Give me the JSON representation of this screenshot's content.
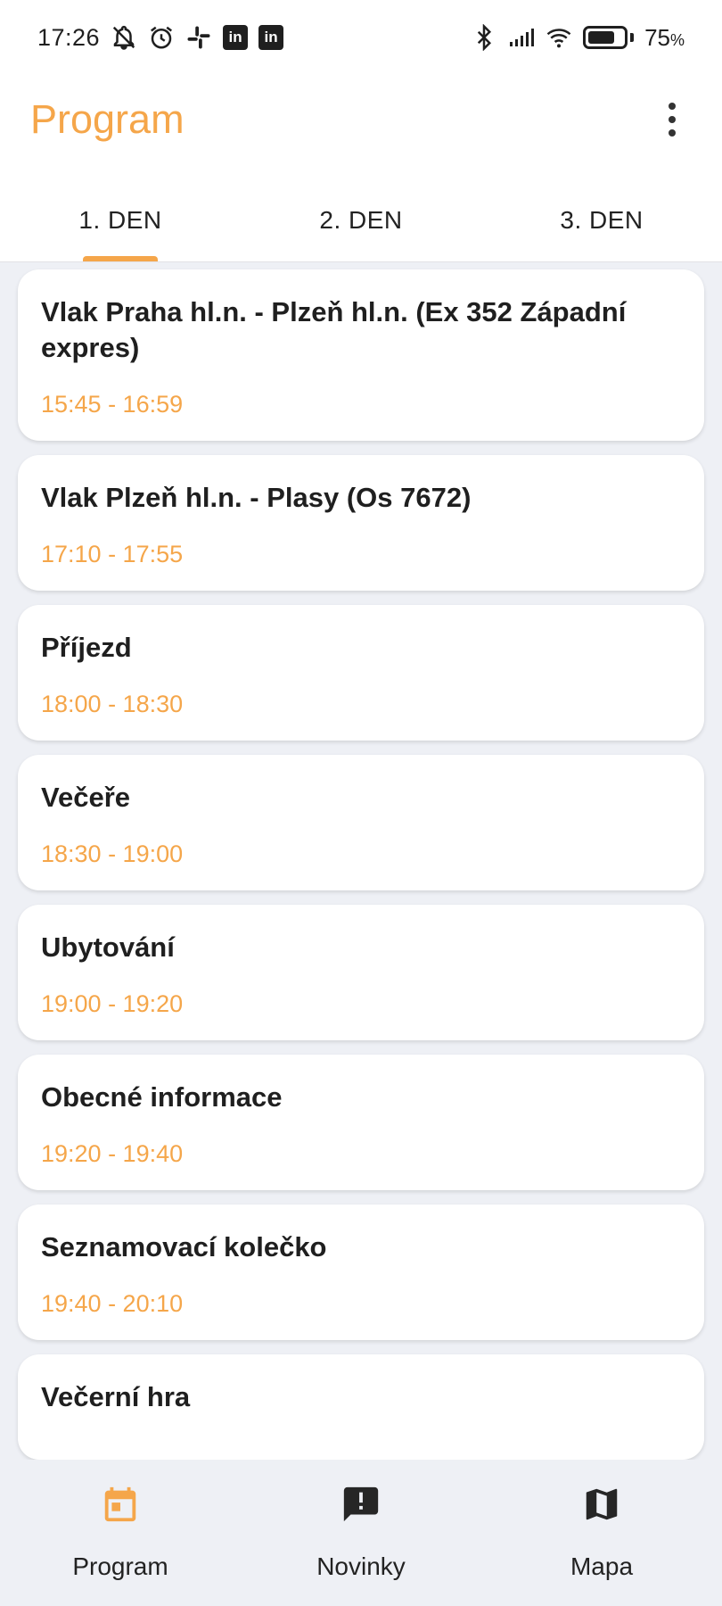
{
  "status_bar": {
    "time": "17:26",
    "battery_percent": "75",
    "battery_unit": "%",
    "battery_level": 0.75,
    "left_icons": [
      "bell-off-icon",
      "alarm-icon",
      "slack-icon",
      "linkedin-icon",
      "linkedin-icon"
    ],
    "right_icons": [
      "bluetooth-icon",
      "signal-icon",
      "wifi-icon",
      "battery-icon"
    ],
    "linkedin_text": "in"
  },
  "app_bar": {
    "title": "Program",
    "menu_icon": "more-vert-icon"
  },
  "tabs": [
    {
      "label": "1. DEN",
      "active": true
    },
    {
      "label": "2. DEN",
      "active": false
    },
    {
      "label": "3. DEN",
      "active": false
    }
  ],
  "events": [
    {
      "title": "Vlak Praha hl.n. - Plzeň hl.n. (Ex 352 Západní expres)",
      "time": "15:45 - 16:59"
    },
    {
      "title": "Vlak Plzeň hl.n. - Plasy (Os 7672)",
      "time": "17:10 - 17:55"
    },
    {
      "title": "Příjezd",
      "time": "18:00 - 18:30"
    },
    {
      "title": "Večeře",
      "time": "18:30 - 19:00"
    },
    {
      "title": "Ubytování",
      "time": "19:00 - 19:20"
    },
    {
      "title": "Obecné informace",
      "time": "19:20 - 19:40"
    },
    {
      "title": "Seznamovací kolečko",
      "time": "19:40 - 20:10"
    },
    {
      "title": "Večerní hra",
      "time": ""
    }
  ],
  "bottom_nav": [
    {
      "label": "Program",
      "icon": "calendar-icon",
      "active": true
    },
    {
      "label": "Novinky",
      "icon": "announcement-icon",
      "active": false
    },
    {
      "label": "Mapa",
      "icon": "map-icon",
      "active": false
    }
  ],
  "colors": {
    "accent": "#f5a64a",
    "background": "#eef0f5",
    "card": "#ffffff",
    "text": "#1f1f1f"
  }
}
